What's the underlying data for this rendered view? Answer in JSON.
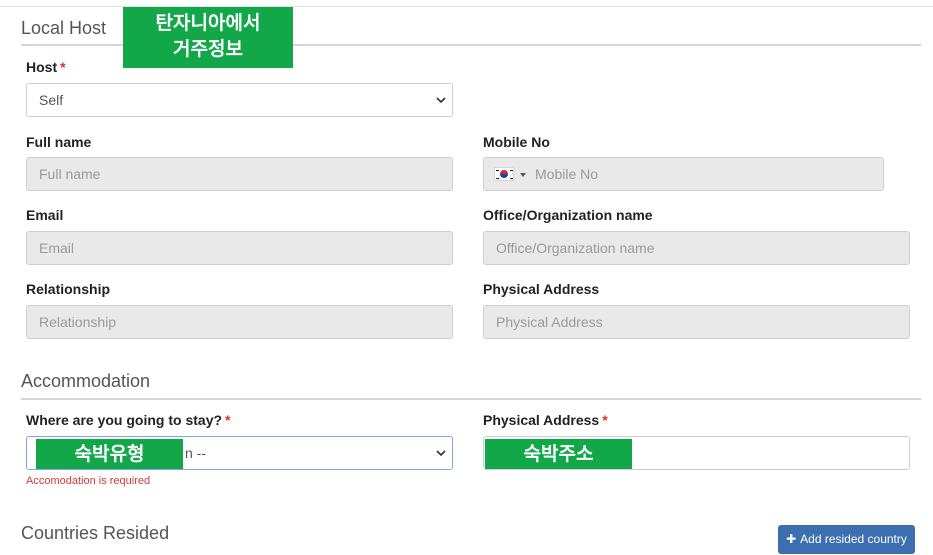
{
  "local_host": {
    "title": "Local Host",
    "overlay": [
      "탄자니아에서",
      "거주정보"
    ],
    "host": {
      "label": "Host",
      "required_mark": "*",
      "value": "Self"
    },
    "full_name": {
      "label": "Full name",
      "placeholder": "Full name"
    },
    "mobile": {
      "label": "Mobile No",
      "placeholder": "Mobile No",
      "flag": "south-korea-flag-icon"
    },
    "email": {
      "label": "Email",
      "placeholder": "Email"
    },
    "organization": {
      "label": "Office/Organization name",
      "placeholder": "Office/Organization name"
    },
    "relationship": {
      "label": "Relationship",
      "placeholder": "Relationship"
    },
    "physical_address": {
      "label": "Physical Address",
      "placeholder": "Physical Address"
    }
  },
  "accommodation": {
    "title": "Accommodation",
    "stay": {
      "label": "Where are you going to stay?",
      "required_mark": "*",
      "value_visible": "n --",
      "overlay": "숙박유형",
      "error": "Accomodation is required"
    },
    "address": {
      "label": "Physical Address",
      "required_mark": "*",
      "overlay": "숙박주소"
    }
  },
  "countries": {
    "title": "Countries Resided",
    "add_button": "Add resided country",
    "add_icon": "plus-icon"
  },
  "colors": {
    "overlay_green": "#12a84a",
    "required_red": "#e22c2c",
    "button_blue": "#3c6fb0"
  }
}
